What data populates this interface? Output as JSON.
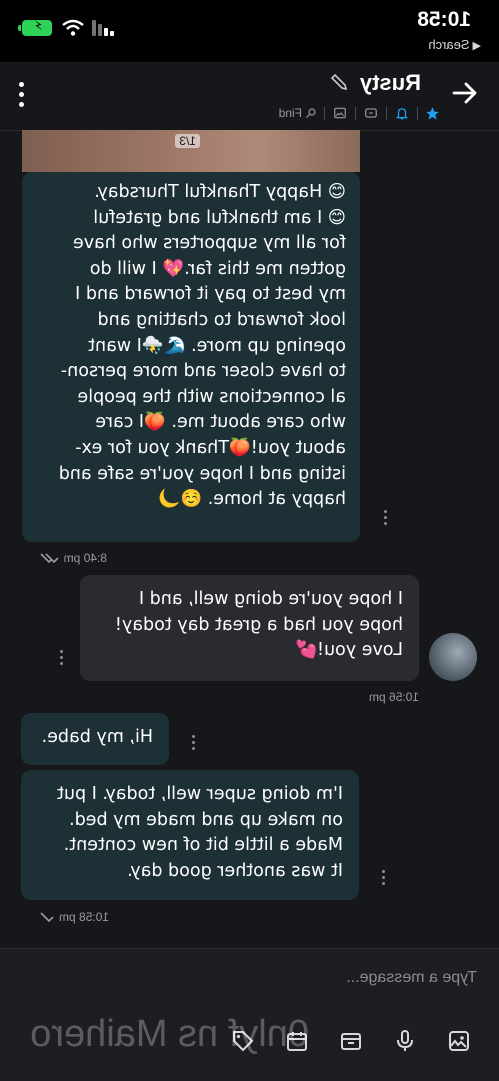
{
  "status_bar": {
    "time": "10:58",
    "back_app": "Search"
  },
  "header": {
    "title": "Rusty",
    "find_label": "Find"
  },
  "messages": [
    {
      "id": "m1",
      "direction": "received",
      "photo_counter": "1/3",
      "text": "😊 Happy Thankful Thursday.\n😊 I am thankful and grateful\nfor all my supporters who have\ngotten me this far.💖 I will do\nmy best to pay it forward and I\nlook forward to chatting and\nopening up more. 🌊⛈️I want\nto have closer and more person-\nal connections with the people\nwho care about me. 🍑I care\nabout you!🍑Thank you for ex-\nisting and I hope you're safe and\nhappy at home. ☺️🌙",
      "time": "8:40 pm"
    },
    {
      "id": "m2",
      "direction": "sent",
      "text": "I hope you're doing well, and I\nhope you had a great day today!\nLove you!💕",
      "time": "10:56 pm"
    },
    {
      "id": "m3",
      "direction": "received",
      "text": "Hi, my babe."
    },
    {
      "id": "m4",
      "direction": "received",
      "text": "I'm doing super well, today. I put\non make up and made my bed.\nMade a little bit of new content.\nIt was another good day.",
      "time": "10:58 pm"
    }
  ],
  "composer": {
    "placeholder": "Type a message...",
    "watermark": "0nlyf ns Maihero"
  },
  "colors": {
    "background": "#16171b",
    "received_bubble": "#1c3035",
    "sent_bubble": "#2a2b30",
    "accent": "#1da1f2",
    "battery": "#2fd158"
  },
  "icons": [
    "back-arrow-icon",
    "edit-icon",
    "more-icon",
    "star-icon",
    "bell-icon",
    "dollar-icon",
    "image-icon",
    "search-icon",
    "kebab-icon",
    "double-check-icon",
    "image-upload-icon",
    "mic-icon",
    "vault-icon",
    "calendar-icon",
    "tag-icon"
  ]
}
